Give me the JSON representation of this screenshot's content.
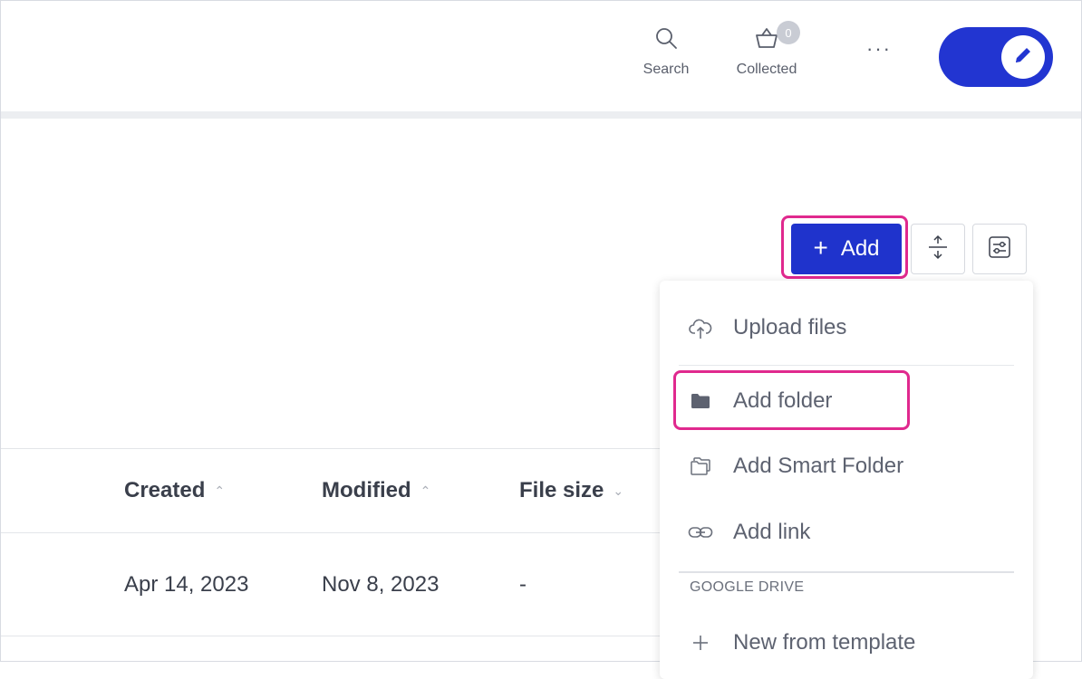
{
  "header": {
    "search_label": "Search",
    "collected_label": "Collected",
    "collected_count": "0",
    "more_label": "···",
    "toggle_state": "on"
  },
  "toolbar": {
    "add_label": "Add"
  },
  "table": {
    "columns": [
      {
        "label": "Created",
        "sort": "asc"
      },
      {
        "label": "Modified",
        "sort": "asc"
      },
      {
        "label": "File size",
        "sort": "desc"
      }
    ],
    "rows": [
      {
        "created": "Apr 14, 2023",
        "modified": "Nov 8, 2023",
        "file_size": "-"
      }
    ]
  },
  "menu": {
    "items": [
      {
        "label": "Upload files",
        "icon": "cloud-upload-icon"
      },
      {
        "label": "Add folder",
        "icon": "folder-icon"
      },
      {
        "label": "Add Smart Folder",
        "icon": "smart-folder-icon"
      },
      {
        "label": "Add link",
        "icon": "link-icon"
      }
    ],
    "google_section_label": "GOOGLE DRIVE",
    "google_items": [
      {
        "label": "New from template",
        "icon": "plus-icon"
      }
    ]
  },
  "colors": {
    "brand_blue": "#1f33cc",
    "highlight_pink": "#e0298e"
  }
}
